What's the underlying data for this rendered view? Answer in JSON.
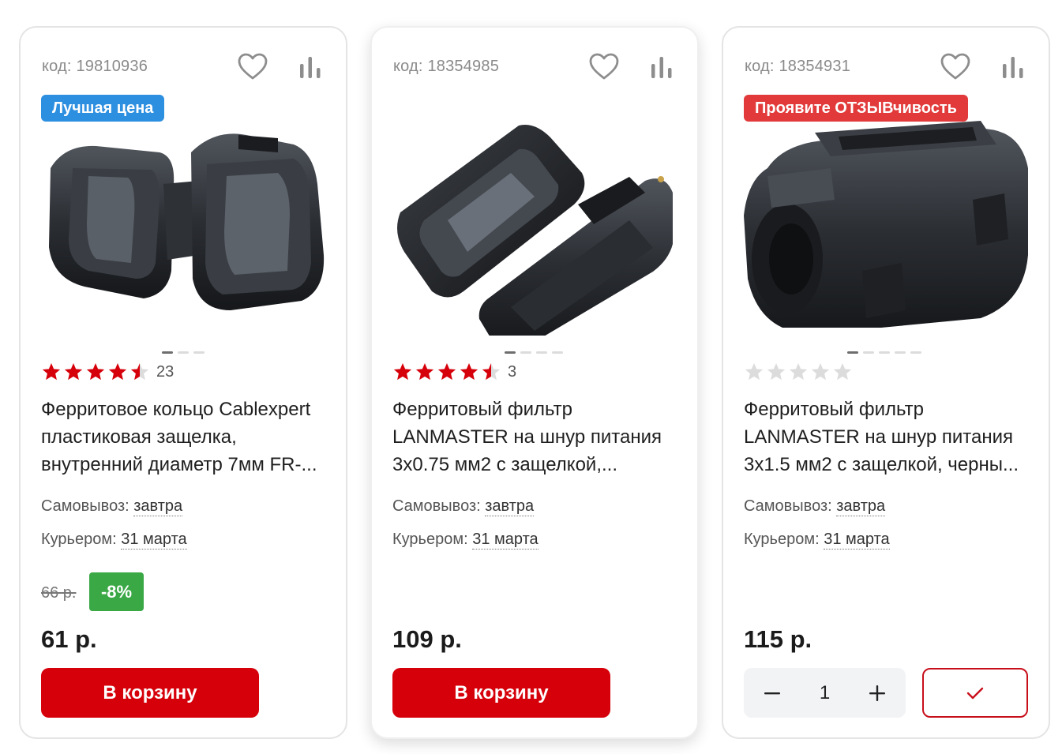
{
  "products": [
    {
      "code": "код: 19810936",
      "badge": "Лучшая цена",
      "badge_color": "#2d8fe0",
      "image_dots": 3,
      "active_dot": 0,
      "rating": 4.5,
      "rating_count": "23",
      "title_lines": [
        "Ферритовое кольцо Cablexpert",
        "пластиковая защелка,",
        "внутренний диаметр 7мм FR-..."
      ],
      "pickup_label": "Самовывоз:",
      "pickup_value": "завтра",
      "courier_label": "Курьером:",
      "courier_value": "31 марта",
      "old_price": "66 р.",
      "discount": "-8%",
      "price": "61 р.",
      "button": "В корзину"
    },
    {
      "code": "код: 18354985",
      "image_dots": 4,
      "active_dot": 0,
      "rating": 4.5,
      "rating_count": "3",
      "title_lines": [
        "Ферритовый фильтр",
        "LANMASTER на шнур питания",
        "3х0.75 мм2 с защелкой,..."
      ],
      "pickup_label": "Самовывоз:",
      "pickup_value": "завтра",
      "courier_label": "Курьером:",
      "courier_value": "31 марта",
      "price": "109 р.",
      "button": "В корзину"
    },
    {
      "code": "код: 18354931",
      "badge": "Проявите ОТЗЫВчивость",
      "badge_color": "#e23a3a",
      "image_dots": 5,
      "active_dot": 0,
      "rating": 0,
      "title_lines": [
        "Ферритовый фильтр",
        "LANMASTER на шнур питания",
        "3х1.5 мм2 с защелкой, черны..."
      ],
      "pickup_label": "Самовывоз:",
      "pickup_value": "завтра",
      "courier_label": "Курьером:",
      "courier_value": "31 марта",
      "price": "115 р.",
      "quantity": "1"
    }
  ],
  "colors": {
    "accent_red": "#d6000a",
    "star_red": "#d6000a",
    "discount_green": "#3aa845"
  },
  "icons": {
    "favorite": "heart-outline-icon",
    "compare": "bar-chart-icon",
    "minus": "minus-icon",
    "plus": "plus-icon",
    "in_cart": "checkmark-icon"
  }
}
